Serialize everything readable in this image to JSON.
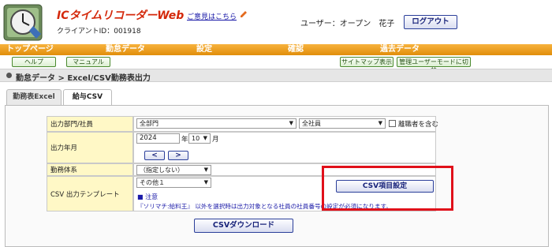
{
  "header": {
    "app_title": "ICタイムリコーダーWeb",
    "client_id": "クライアントID：001918",
    "feedback_link": "ご意見はこちら",
    "user_label": "ユーザー：オープン　花子",
    "logout_label": "ログアウト",
    "logo_icon": "clock-logo-icon",
    "feedback_icon": "pencil-icon"
  },
  "nav": {
    "items": [
      "トップページ",
      "勤怠データ",
      "設定",
      "確認",
      "過去データ"
    ]
  },
  "subnav": {
    "help": "ヘルプ",
    "manual": "マニュアル",
    "sitemap": "サイトマップ表示",
    "admin_mode": "管理ユーザーモードに切替"
  },
  "breadcrumb": "勤怠データ > Excel/CSV勤務表出力",
  "tabs": {
    "excel": "勤務表Excel",
    "csv": "給与CSV"
  },
  "form": {
    "department_label": "出力部門/社員",
    "department_value": "全部門",
    "employee_value": "全社員",
    "include_retired_label": "離職者を含む",
    "year_month_label": "出力年月",
    "year_value": "2024",
    "year_suffix": "年",
    "month_value": "10",
    "month_suffix": "月",
    "prev_btn": "<",
    "next_btn": ">",
    "work_type_label": "勤務体系",
    "work_type_value": "（指定しない）",
    "template_label": "CSV 出力テンプレート",
    "template_value": "その他１",
    "note_marker": "■ 注意",
    "note_text": "『ソリマチ:給料王』 以外を選択時は出力対象となる社員の社員番号の設定が必須になります。",
    "csv_item_btn": "CSV項目設定"
  },
  "download_btn": "CSVダウンロード",
  "colors": {
    "nav_bg": "#eb9a1d",
    "label_bg": "#fff8c6",
    "accent_red": "#e0101a",
    "title_red": "#d4280a"
  }
}
